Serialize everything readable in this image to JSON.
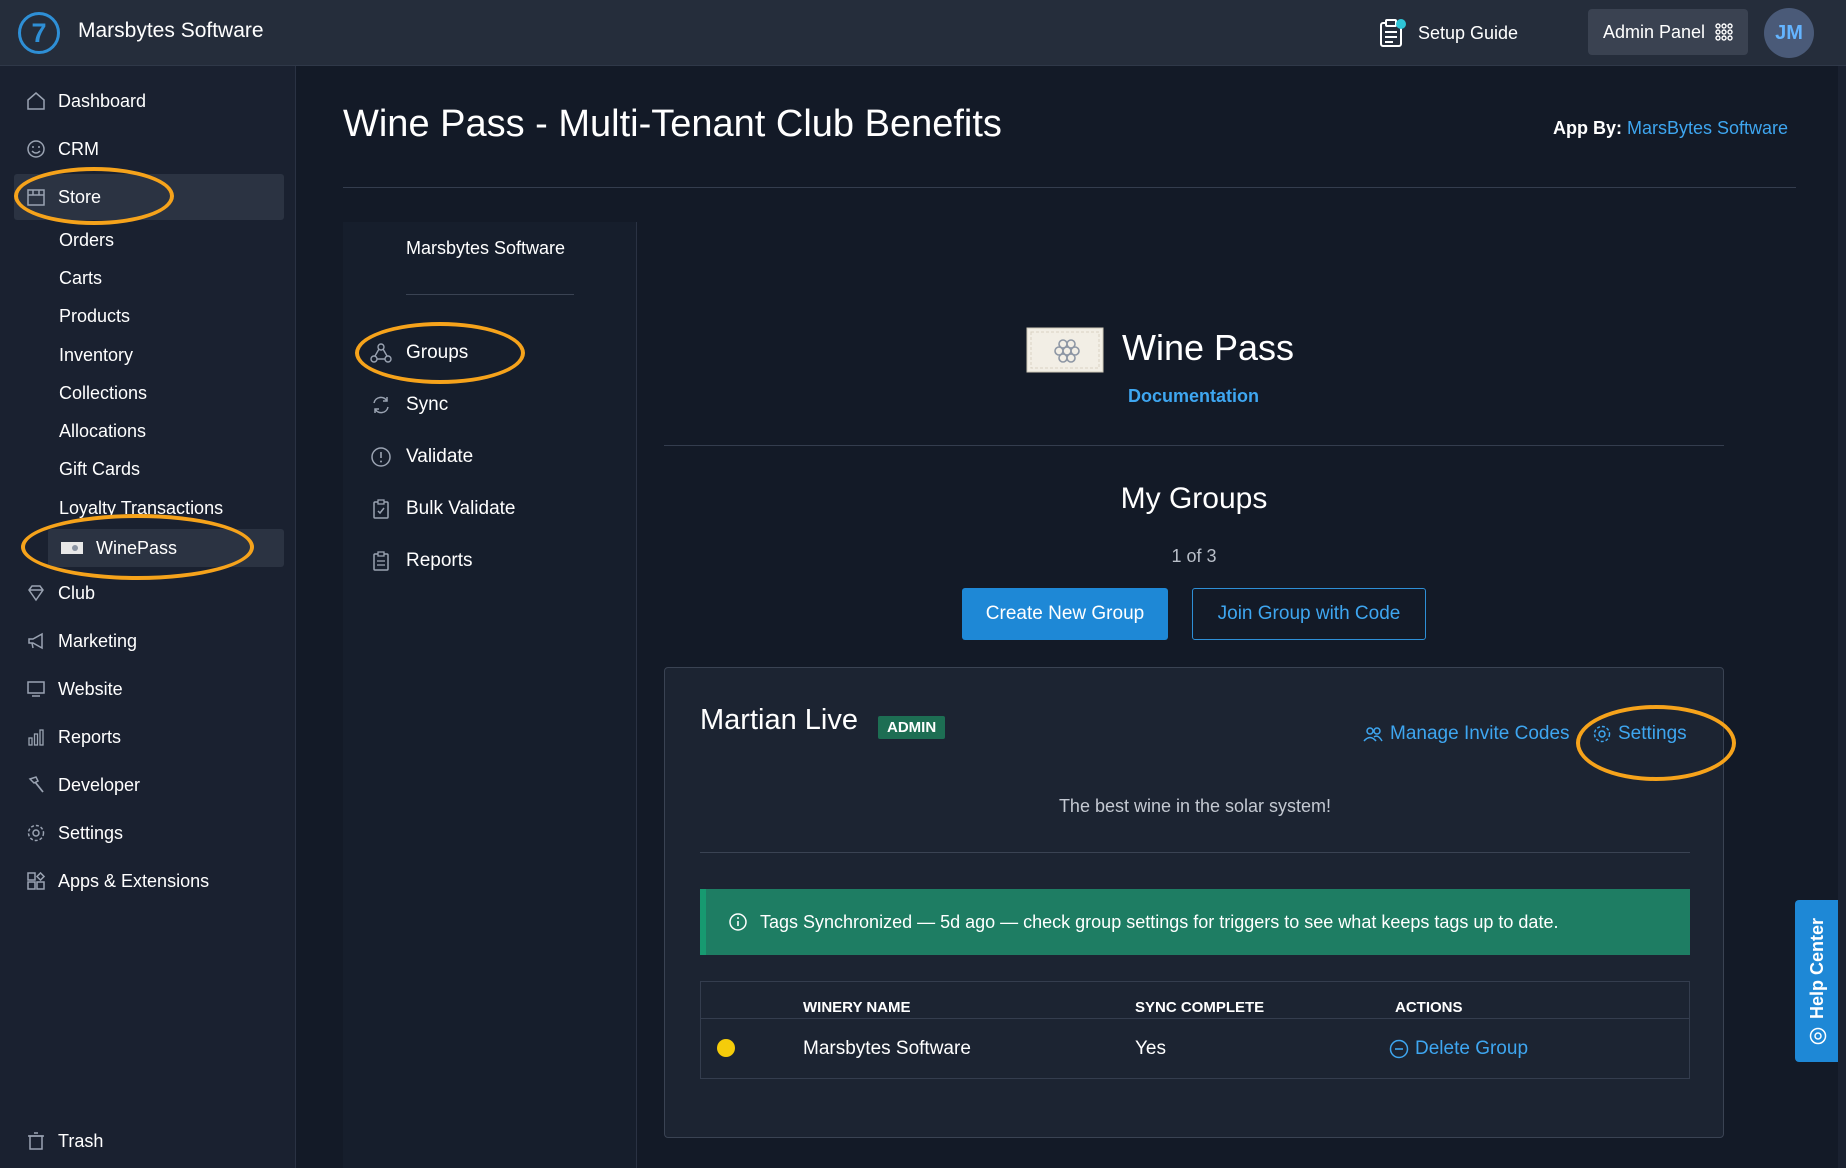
{
  "header": {
    "brand": "Marsbytes Software",
    "setup_guide": "Setup Guide",
    "admin_panel": "Admin Panel",
    "avatar_initials": "JM"
  },
  "sidebar": {
    "dashboard": "Dashboard",
    "crm": "CRM",
    "store": "Store",
    "store_sub": [
      "Orders",
      "Carts",
      "Products",
      "Inventory",
      "Collections",
      "Allocations",
      "Gift Cards",
      "Loyalty Transactions"
    ],
    "winepass": "WinePass",
    "club": "Club",
    "marketing": "Marketing",
    "website": "Website",
    "reports": "Reports",
    "developer": "Developer",
    "settings": "Settings",
    "apps": "Apps & Extensions",
    "trash": "Trash"
  },
  "page": {
    "title": "Wine Pass - Multi-Tenant Club Benefits",
    "app_by_label": "App By:",
    "app_by_name": "MarsBytes Software"
  },
  "subnav": {
    "title": "Marsbytes Software",
    "items": [
      "Groups",
      "Sync",
      "Validate",
      "Bulk Validate",
      "Reports"
    ]
  },
  "content": {
    "app_name": "Wine Pass",
    "documentation": "Documentation",
    "my_groups": "My Groups",
    "count": "1 of 3",
    "create_button": "Create New Group",
    "join_button": "Join Group with Code"
  },
  "group": {
    "name": "Martian Live",
    "badge": "ADMIN",
    "manage_invites": "Manage Invite Codes",
    "settings": "Settings",
    "description": "The best wine in the solar system!",
    "alert": "Tags Synchronized — 5d ago — check group settings for triggers to see what keeps tags up to date.",
    "table": {
      "headers": [
        "WINERY NAME",
        "SYNC COMPLETE",
        "ACTIONS"
      ],
      "rows": [
        {
          "winery": "Marsbytes Software",
          "sync": "Yes",
          "action": "Delete Group"
        }
      ]
    }
  },
  "help_center": "Help Center",
  "colors": {
    "accent": "#1e88d6",
    "link": "#3ea6f0",
    "highlight_ring": "#f6a31b",
    "alert_bg": "#1e7d63",
    "badge_bg": "#1d6e53",
    "status_dot": "#f5cc0a"
  }
}
